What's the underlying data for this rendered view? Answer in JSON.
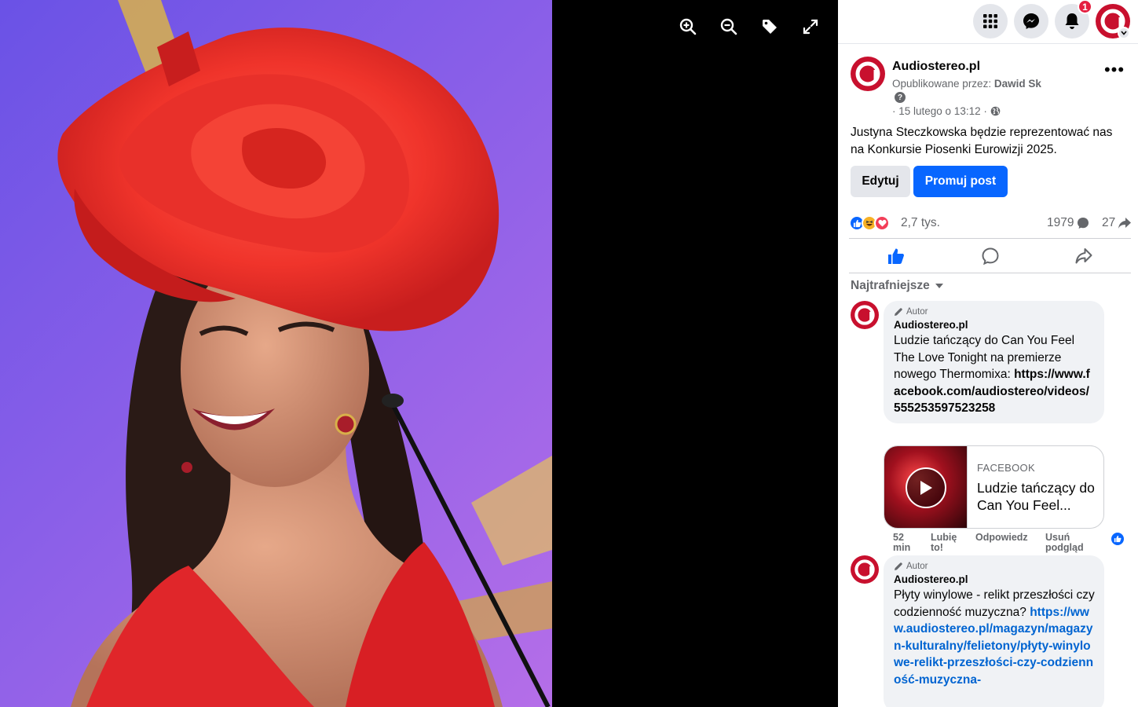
{
  "viewer": {
    "tools": [
      {
        "name": "zoom-in-icon"
      },
      {
        "name": "zoom-out-icon"
      },
      {
        "name": "tag-icon"
      },
      {
        "name": "fullscreen-icon"
      }
    ]
  },
  "topbar": {
    "notification_count": "1",
    "colors": {
      "brand": "#c8102e",
      "button_bg": "#e4e6eb",
      "badge": "#e41e3f"
    }
  },
  "post": {
    "page_name": "Audiostereo.pl",
    "published_by_label": "Opublikowane przez:",
    "published_by_name": "Dawid Sk",
    "help_symbol": "?",
    "date": "· 15 lutego o 13:12 ·",
    "more_symbol": "•••",
    "text": "Justyna Steczkowska będzie reprezentować nas na Konkursie Piosenki Eurowizji 2025.",
    "edit_label": "Edytuj",
    "promote_label": "Promuj post",
    "reactions_count": "2,7 tys.",
    "comments_count": "1979",
    "shares_count": "27",
    "sort_label": "Najtrafniejsze",
    "accent": "#0866ff"
  },
  "comments": [
    {
      "author_tag": "Autor",
      "name": "Audiostereo.pl",
      "text": "Ludzie tańczący do Can You Feel The Love Tonight na premierze nowego Thermomixa:",
      "link": "https://www.facebook.com/audiostereo/videos/555253597523258",
      "preview_source": "FACEBOOK",
      "preview_title": "Ludzie tańczący do Can You Feel...",
      "time": "52 min",
      "like": "Lubię to!",
      "reply": "Odpowiedz",
      "remove_preview": "Usuń podgląd"
    },
    {
      "author_tag": "Autor",
      "name": "Audiostereo.pl",
      "text": "Płyty winylowe - relikt przeszłości czy codzienność muzyczna?",
      "link": "https://www.audiostereo.pl/magazyn/magazyn-kulturalny/felietony/płyty-winylowe-relikt-przeszłości-czy-codzienność-muzyczna-"
    }
  ]
}
